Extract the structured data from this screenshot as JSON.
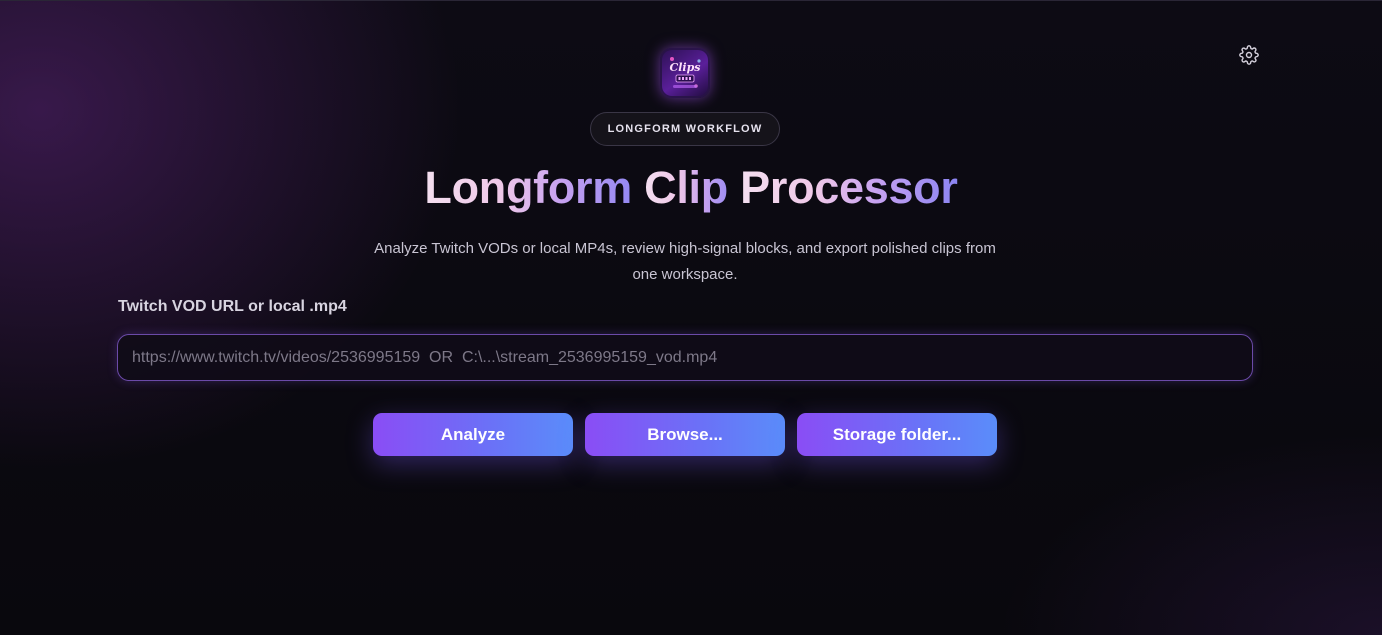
{
  "header": {
    "badge": "LONGFORM WORKFLOW",
    "title_part1": "Longform ",
    "title_part2": "Clip ",
    "title_part3": "Processor",
    "subtitle_line1": "Analyze Twitch VODs or local MP4s, review high-signal blocks, and export polished clips from",
    "subtitle_line2": "one workspace."
  },
  "logo": {
    "text": "Clips",
    "icon": "app-logo"
  },
  "settings": {
    "icon": "gear-icon"
  },
  "source_input": {
    "label": "Twitch VOD URL or local .mp4",
    "value": "",
    "placeholder": "https://www.twitch.tv/videos/2536995159  OR  C:\\...\\stream_2536995159_vod.mp4"
  },
  "actions": {
    "analyze": "Analyze",
    "browse": "Browse...",
    "storage": "Storage folder..."
  },
  "colors": {
    "accent_start": "#8a4df5",
    "accent_end": "#5a8dfa",
    "background": "#09080d"
  }
}
